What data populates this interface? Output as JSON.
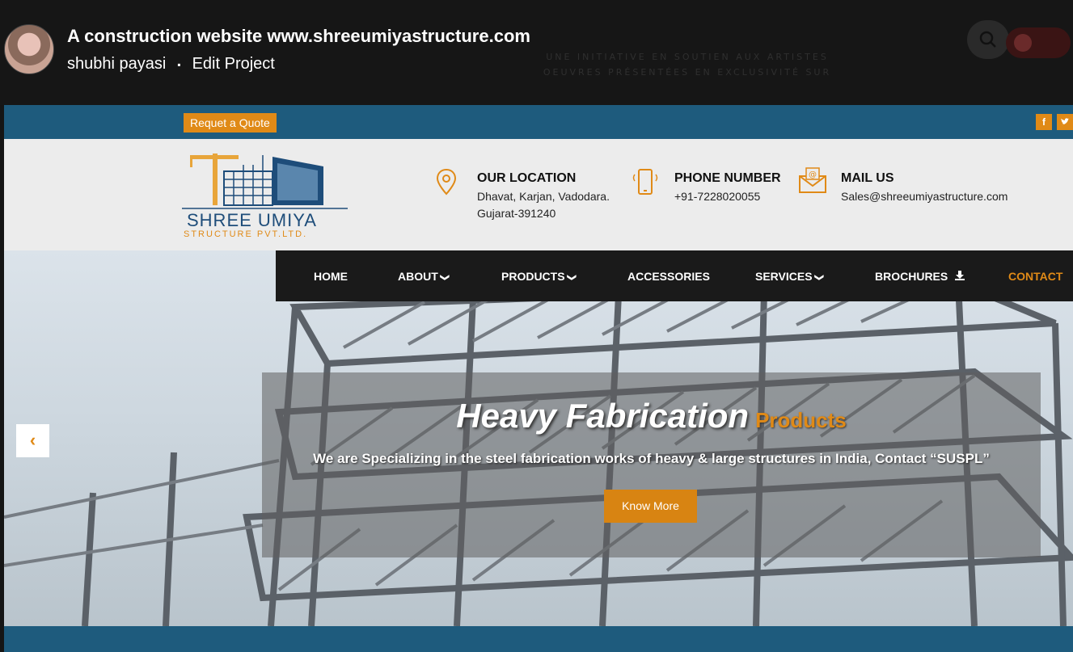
{
  "overlay": {
    "project_title": "A construction website www.shreeumiyastructure.com",
    "author": "shubhi payasi",
    "separator": "▪",
    "edit_link": "Edit Project",
    "bg_text_1": "UNE INITIATIVE EN SOUTIEN AUX ARTISTES",
    "bg_text_2": "OEUVRES PRÉSENTÉES EN EXCLUSIVITÉ SUR"
  },
  "topbar": {
    "quote_label": "Requet a Quote",
    "facebook": "f",
    "twitter": "t"
  },
  "logo": {
    "name": "SHREE UMIYA",
    "sub": "STRUCTURE PVT.LTD."
  },
  "contact": {
    "location_title": "OUR LOCATION",
    "location_line1": "Dhavat, Karjan, Vadodara.",
    "location_line2": "Gujarat-391240",
    "phone_title": "PHONE NUMBER",
    "phone_value": "+91-7228020055",
    "mail_title": "MAIL US",
    "mail_value": "Sales@shreeumiyastructure.com"
  },
  "nav": {
    "home": "HOME",
    "about": "ABOUT",
    "products": "PRODUCTS",
    "accessories": "ACCESSORIES",
    "services": "SERVICES",
    "brochures": "BROCHURES",
    "contact": "CONTACT"
  },
  "hero": {
    "heading_main": "Heavy Fabrication",
    "heading_accent": "Products",
    "subtext": "We are Specializing in the steel fabrication works of heavy & large structures in India, Contact “SUSPL”",
    "button": "Know More",
    "prev_arrow": "‹"
  },
  "colors": {
    "accent": "#e08a17",
    "brand_blue": "#1e5b7d",
    "nav_bg": "#1a1a1a"
  }
}
